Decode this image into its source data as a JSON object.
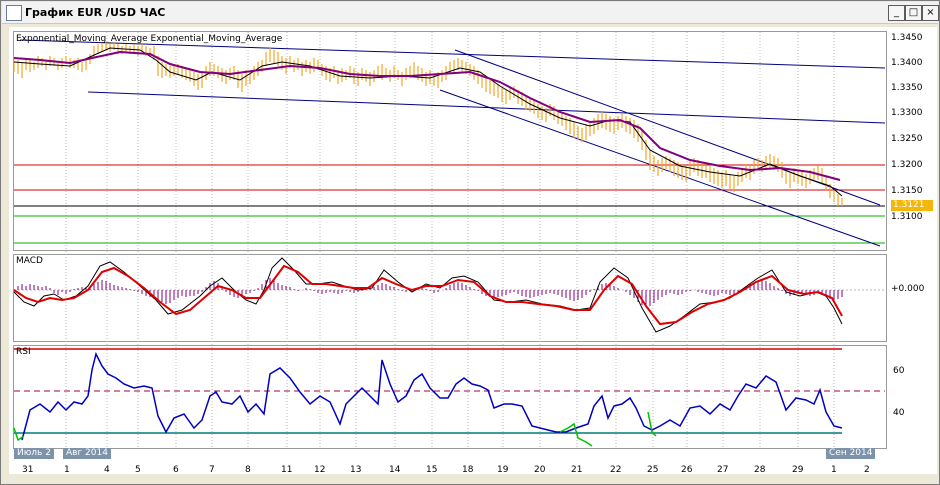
{
  "window": {
    "title": "График EUR /USD ЧАС",
    "minimize": "_",
    "maximize": "□",
    "close": "×"
  },
  "main_panel": {
    "indicator_label": "Exponential_Moving_Average Exponential_Moving_Average",
    "y_ticks": [
      "1.3450",
      "1.3400",
      "1.3350",
      "1.3300",
      "1.3250",
      "1.3200",
      "1.3150",
      "1.3100"
    ],
    "current_price": "1.3121"
  },
  "macd_panel": {
    "label": "MACD",
    "zero_tick": "+0.000"
  },
  "rsi_panel": {
    "label": "RSI",
    "ticks": [
      "60",
      "40"
    ]
  },
  "x_axis": {
    "labels": [
      "31",
      "1",
      "4",
      "5",
      "6",
      "7",
      "8",
      "11",
      "12",
      "13",
      "14",
      "15",
      "18",
      "19",
      "20",
      "21",
      "22",
      "25",
      "26",
      "27",
      "28",
      "29",
      "1",
      "2"
    ],
    "month_tags": [
      "Июль 2",
      "Авг 2014",
      "Сен 2014"
    ]
  },
  "colors": {
    "price": "#f5a623",
    "ema_fast": "#000000",
    "ema_slow": "#800080",
    "trend": "#000080",
    "hline_red": "#d40000",
    "hline_green": "#00b000",
    "macd": "#000000",
    "signal": "#e00000",
    "hist": "#800080",
    "rsi": "#0000c0",
    "rsi_oversold": "#00c000"
  }
}
